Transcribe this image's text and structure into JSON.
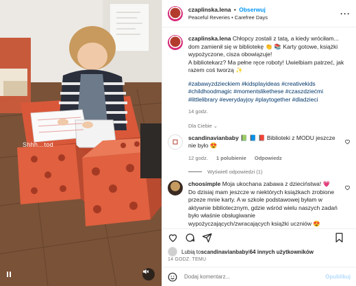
{
  "photo": {
    "caption": "Shhh…tod",
    "mute_icon": "speaker-muted-icon"
  },
  "header": {
    "username": "czaplinska.lena",
    "separator": "•",
    "follow_label": "Obserwuj",
    "subtitle": "Peaceful Reveries • Carefree Days",
    "more_icon": "more-horizontal-icon"
  },
  "caption": {
    "username": "czaplinska.lena",
    "text": "Chłopcy zostali z tatą, a kiedy wróciłam... dom zamienił się w bibliotekę 👏 📚 Karty gotowe, książki wypożyczone, cisza obowiązuje!",
    "text2": "A bibliotekarz? Ma pełne ręce roboty! Uwielbiam patrzeć, jak razem coś tworzą ✨",
    "hashtags": "#zabawyzdzieckiem #kidsplayideas #creativekids #childhoodmagic #momentslikethese #czaszdziećmi #littlelibrary #everydayjoy #playtogether #dladzieci",
    "time": "14 godz."
  },
  "translate_label": "Dla Ciebie ⌄",
  "comments": [
    {
      "username": "scandinavianbaby",
      "text": "📗 📘 📕 Biblioteki z MODU jeszcze nie było 😍",
      "time": "12 godz.",
      "likes": "1 polubienie",
      "reply": "Odpowiedz"
    },
    {
      "username": "choosimple",
      "text": "Moja ukochana zabawa z dzieciństwa! 💗 Do dzisiaj mam jeszcze w niektórych książkach zrobione przeze mnie karty. A w szkole podstawowej byłam w aktywnie bibliotecznym, gdzie wśród wielu naszych zadań było właśnie obsługiwanie wypożyczających/zwracających książki uczniów 😍"
    }
  ],
  "view_replies": "Wyświetl odpowiedzi (1)",
  "likes": {
    "prefix": "Lubią to ",
    "user": "scandinavianbaby",
    "middle": " i ",
    "others": "64 innych użytkowników"
  },
  "timestamp": "14 GODZ. TEMU",
  "comment_box": {
    "placeholder": "Dodaj komentarz...",
    "publish_label": "Opublikuj"
  },
  "colors": {
    "accent": "#0095f6",
    "hashtag": "#00376b",
    "muted": "#737373",
    "publish_disabled": "#b3dbff"
  }
}
